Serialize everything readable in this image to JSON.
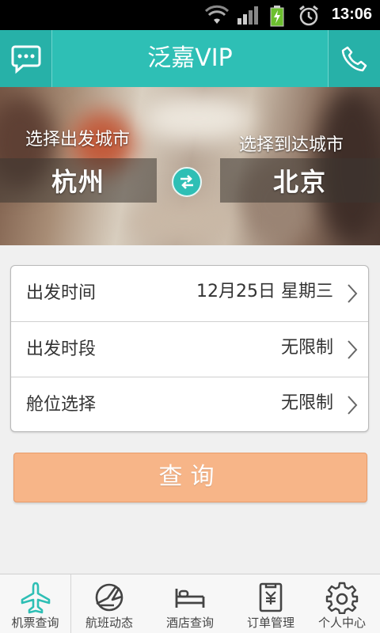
{
  "status_bar": {
    "time": "13:06"
  },
  "header": {
    "title": "泛嘉VIP",
    "left_icon": "chat-icon",
    "right_icon": "phone-icon"
  },
  "banner": {
    "depart_label": "选择出发城市",
    "arrive_label": "选择到达城市",
    "depart_city": "杭州",
    "arrive_city": "北京",
    "swap_icon": "swap-arrows-icon"
  },
  "form": {
    "rows": [
      {
        "label": "出发时间",
        "value": "12月25日 星期三"
      },
      {
        "label": "出发时段",
        "value": "无限制"
      },
      {
        "label": "舱位选择",
        "value": "无限制"
      }
    ]
  },
  "query_button": {
    "label": "查询"
  },
  "bottom_nav": {
    "items": [
      {
        "label": "机票查询",
        "icon": "airplane-icon",
        "active": true
      },
      {
        "label": "航班动态",
        "icon": "flight-status-icon"
      },
      {
        "label": "酒店查询",
        "icon": "bed-icon"
      },
      {
        "label": "订单管理",
        "icon": "receipt-icon"
      },
      {
        "label": "个人中心",
        "icon": "gear-icon"
      }
    ]
  },
  "colors": {
    "accent": "#2ebfb5",
    "button": "#f7b588",
    "active_nav": "#2ebfb5"
  }
}
